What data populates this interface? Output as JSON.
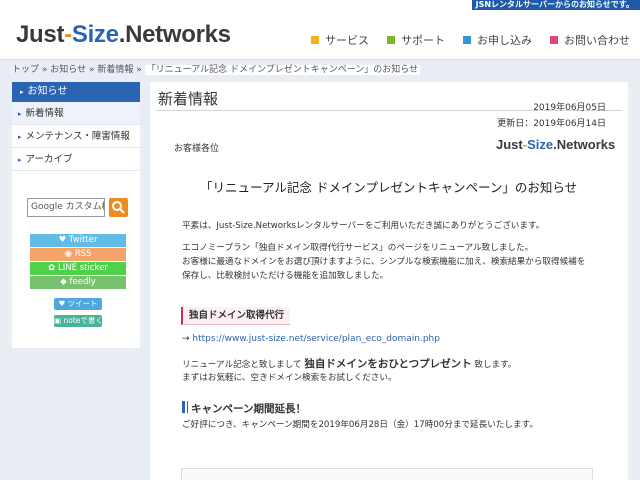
{
  "topbar": {
    "notice": "JSNレンタルサーバーからのお知らせです。"
  },
  "header": {
    "logo": {
      "part1": "Just",
      "dash": "-",
      "part2": "Size",
      "dot": ".",
      "part3": "Networks"
    },
    "nav": [
      {
        "label": "サービス",
        "color": "#f3b11c"
      },
      {
        "label": "サポート",
        "color": "#7ab829"
      },
      {
        "label": "お申し込み",
        "color": "#2f95d5"
      },
      {
        "label": "お問い合わせ",
        "color": "#e2467a"
      }
    ]
  },
  "breadcrumb": {
    "items": [
      "トップ",
      "お知らせ",
      "新着情報"
    ],
    "separator": " » ",
    "current": "「リニューアル記念 ドメインプレゼントキャンペーン」のお知らせ"
  },
  "sidebar": {
    "heading": "お知らせ",
    "items": [
      "新着情報",
      "メンテナンス・障害情報",
      "アーカイブ"
    ],
    "search_placeholder": "Google カスタム検索",
    "social": [
      "Twitter",
      "RSS",
      "LINE sticker",
      "feedly"
    ],
    "share": [
      "ツイート",
      "noteで書く"
    ]
  },
  "main": {
    "title": "新着情報",
    "date": "2019年06月05日",
    "updated": "更新日：2019年06月14日",
    "greeting": "お客様各位",
    "heading": "「リニューアル記念 ドメインプレゼントキャンペーン」のお知らせ",
    "para1": "平素は、Just-Size.Networksレンタルサーバーをご利用いただき誠にありがとうございます。",
    "para2_line1": "エコノミープラン「独自ドメイン取得代行サービス」のページをリニューアル致しました。",
    "para2_line2": "お客様に最適なドメインをお選び頂けますように、シンプルな検索機能に加え、検索結果から取得候補を",
    "para2_line3": "保存し、比較検討いただける機能を追加致しました。",
    "section_title": "独自ドメイン取得代行",
    "link_arrow": "→ ",
    "link": "https://www.just-size.net/service/plan_eco_domain.php",
    "para3_pre": "リニューアル記念と致しまして ",
    "para3_bold": "独自ドメインをおひとつプレゼント",
    "para3_post": " 致します。",
    "para4": "まずはお気軽に、空きドメイン検索をお試しください。",
    "extension_title": "キャンペーン期間延長！",
    "para5": "ご好評につき、キャンペーン期間を2019年06月28日（金）17時00分まで延長いたします。"
  }
}
